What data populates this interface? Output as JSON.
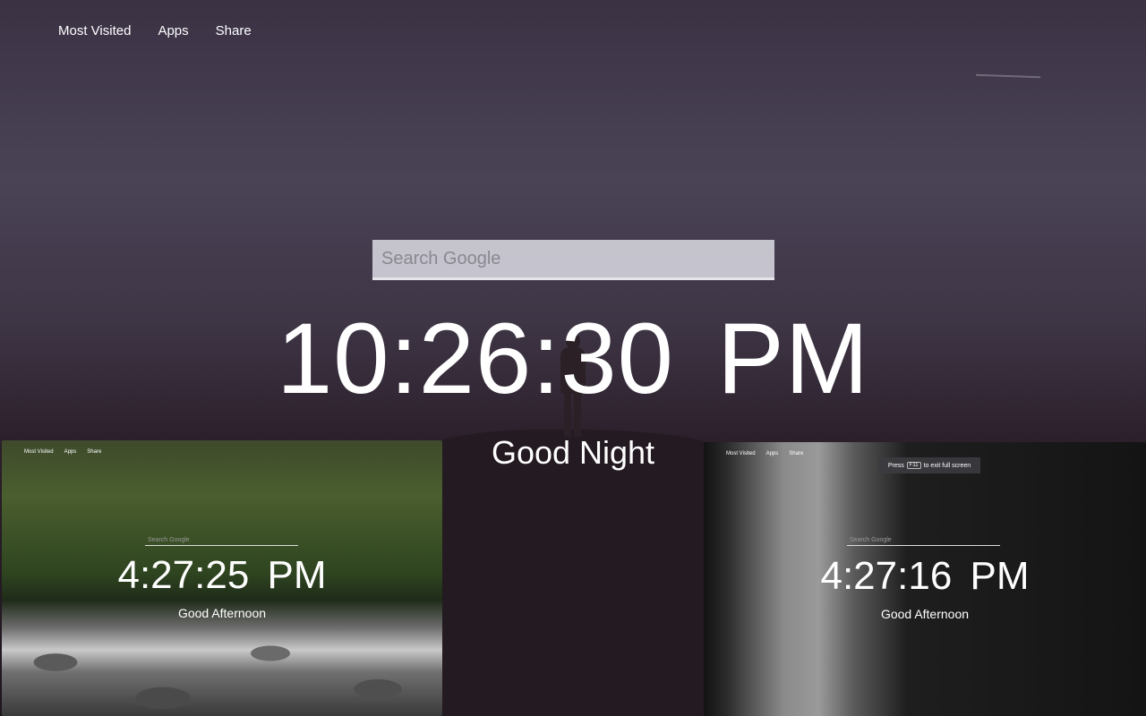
{
  "nav": {
    "most_visited": "Most Visited",
    "apps": "Apps",
    "share": "Share"
  },
  "search": {
    "placeholder": "Search Google"
  },
  "clock": {
    "time": "10:26:30 PM"
  },
  "greeting": "Good Night",
  "thumbnails": [
    {
      "nav": [
        "Most Visited",
        "Apps",
        "Share"
      ],
      "search_placeholder": "Search Google",
      "time": "4:27:25 PM",
      "greeting": "Good Afternoon"
    },
    {
      "nav": [
        "Most Visited",
        "Apps",
        "Share"
      ],
      "search_placeholder": "Search Google",
      "time": "4:27:16 PM",
      "greeting": "Good Afternoon",
      "fullscreen_notice": {
        "press": "Press",
        "key": "F11",
        "rest": "to exit full screen"
      }
    }
  ],
  "colors": {
    "text": "#ffffff",
    "search_bg": "#dcdce4",
    "search_border": "#e6e6ea"
  }
}
